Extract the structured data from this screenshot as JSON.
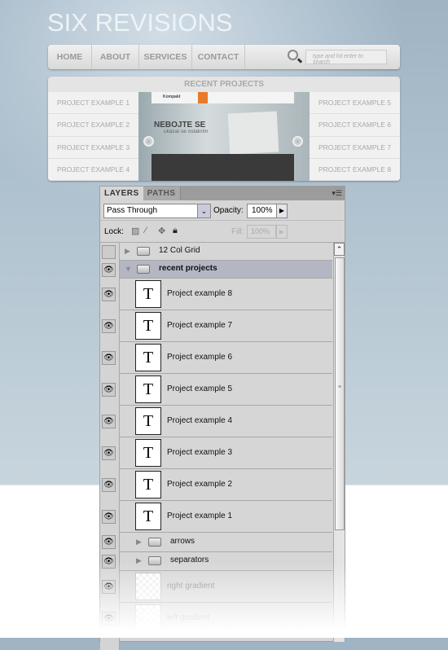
{
  "site": {
    "logo": "SIX REVISIONS",
    "nav": [
      "HOME",
      "ABOUT",
      "SERVICES",
      "CONTACT"
    ],
    "search_placeholder": "type and hit enter to search",
    "recent_title": "RECENT PROJECTS",
    "projects_left": [
      "PROJECT EXAMPLE 1",
      "PROJECT EXAMPLE 2",
      "PROJECT EXAMPLE 3",
      "PROJECT EXAMPLE 4"
    ],
    "projects_right": [
      "PROJECT EXAMPLE 5",
      "PROJECT EXAMPLE 6",
      "PROJECT EXAMPLE 7",
      "PROJECT EXAMPLE 8"
    ],
    "screenshot": {
      "brand": "Kompakt",
      "headline": "NEBOJTE SE",
      "subline": "ukázat se ostatním"
    }
  },
  "panel": {
    "tabs": [
      "LAYERS",
      "PATHS"
    ],
    "blend_mode": "Pass Through",
    "opacity_label": "Opacity:",
    "opacity": "100%",
    "lock_label": "Lock:",
    "fill_label": "Fill:",
    "fill": "100%",
    "layers": [
      {
        "name": "12 Col Grid",
        "type": "group",
        "visible": false,
        "expanded": false,
        "indent": 0
      },
      {
        "name": "recent projects",
        "type": "group",
        "visible": true,
        "expanded": true,
        "selected": true,
        "indent": 0
      },
      {
        "name": "Project example 8",
        "type": "text",
        "visible": true,
        "indent": 1
      },
      {
        "name": "Project example 7",
        "type": "text",
        "visible": true,
        "indent": 1
      },
      {
        "name": "Project example 6",
        "type": "text",
        "visible": true,
        "indent": 1
      },
      {
        "name": "Project example 5",
        "type": "text",
        "visible": true,
        "indent": 1
      },
      {
        "name": "Project example 4",
        "type": "text",
        "visible": true,
        "indent": 1
      },
      {
        "name": "Project example 3",
        "type": "text",
        "visible": true,
        "indent": 1
      },
      {
        "name": "Project example 2",
        "type": "text",
        "visible": true,
        "indent": 1
      },
      {
        "name": "Project example 1",
        "type": "text",
        "visible": true,
        "indent": 1
      },
      {
        "name": "arrows",
        "type": "group",
        "visible": true,
        "expanded": false,
        "indent": 1
      },
      {
        "name": "separators",
        "type": "group",
        "visible": true,
        "expanded": false,
        "indent": 1
      },
      {
        "name": "right gradient",
        "type": "raster",
        "visible": true,
        "indent": 0
      },
      {
        "name": "left gradient",
        "type": "raster",
        "visible": true,
        "indent": 0
      }
    ]
  },
  "colors": {
    "selected_row": "#b4b6c4",
    "accent_orange": "#e87a2c"
  }
}
